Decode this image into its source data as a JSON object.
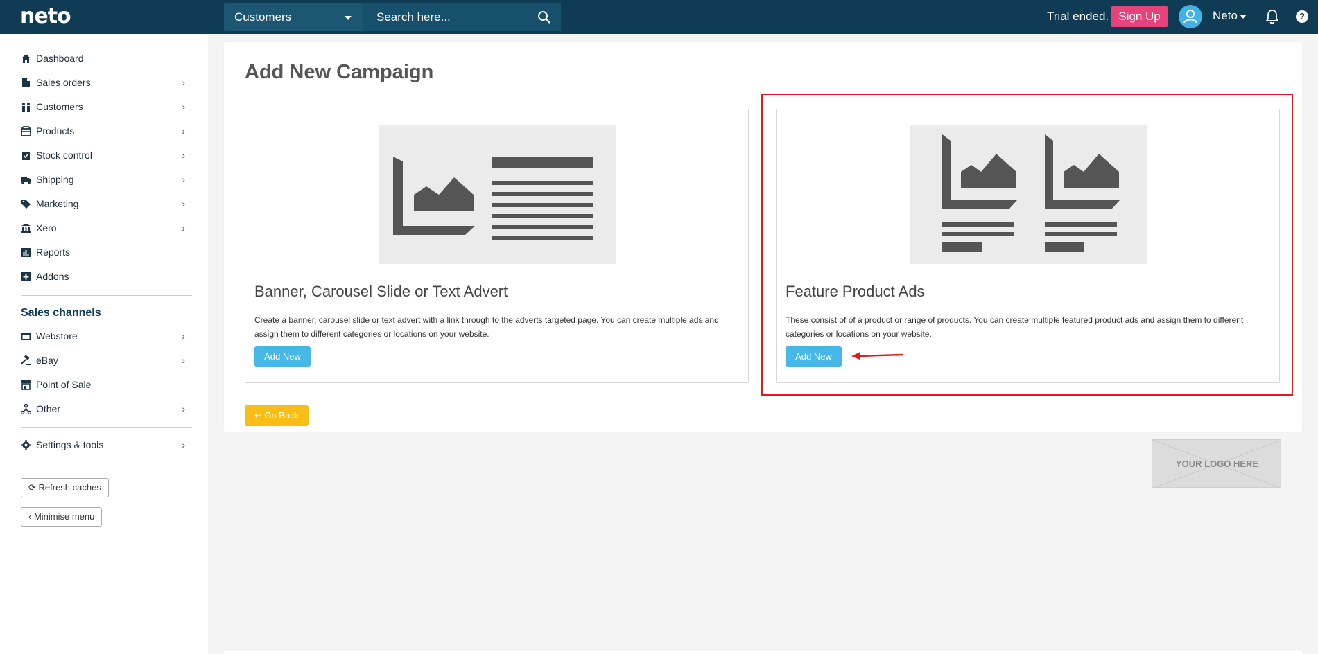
{
  "topbar": {
    "logo": "neto",
    "search_scope": "Customers",
    "search_placeholder": "Search here...",
    "trial_text": "Trial ended.",
    "signup_label": "Sign Up",
    "user_name": "Neto",
    "help_label": "?"
  },
  "sidebar": {
    "items": [
      {
        "label": "Dashboard",
        "icon": "home-icon",
        "chevron": ""
      },
      {
        "label": "Sales orders",
        "icon": "document-icon",
        "chevron": "›"
      },
      {
        "label": "Customers",
        "icon": "people-icon",
        "chevron": "›"
      },
      {
        "label": "Products",
        "icon": "box-icon",
        "chevron": "›"
      },
      {
        "label": "Stock control",
        "icon": "clipboard-check-icon",
        "chevron": "›"
      },
      {
        "label": "Shipping",
        "icon": "truck-icon",
        "chevron": "›"
      },
      {
        "label": "Marketing",
        "icon": "tag-icon",
        "chevron": "›"
      },
      {
        "label": "Xero",
        "icon": "bank-icon",
        "chevron": "›"
      },
      {
        "label": "Reports",
        "icon": "bar-chart-icon",
        "chevron": ""
      },
      {
        "label": "Addons",
        "icon": "plus-square-icon",
        "chevron": ""
      }
    ],
    "section_title": "Sales channels",
    "channels": [
      {
        "label": "Webstore",
        "icon": "browser-icon",
        "chevron": "›"
      },
      {
        "label": "eBay",
        "icon": "gavel-icon",
        "chevron": "›"
      },
      {
        "label": "Point of Sale",
        "icon": "store-icon",
        "chevron": ""
      },
      {
        "label": "Other",
        "icon": "network-icon",
        "chevron": "›"
      }
    ],
    "settings": {
      "label": "Settings & tools",
      "icon": "gear-icon",
      "chevron": "›"
    },
    "refresh_label": "Refresh caches",
    "minimise_label": "Minimise menu"
  },
  "main": {
    "title": "Add New Campaign",
    "cards": [
      {
        "title": "Banner, Carousel Slide or Text Advert",
        "description": "Create a banner, carousel slide or text advert with a link through to the adverts targeted page. You can create multiple ads and assign them to different categories or locations on your website.",
        "button": "Add New"
      },
      {
        "title": "Feature Product Ads",
        "description": "These consist of of a product or range of products. You can create multiple featured product ads and assign them to different categories or locations on your website.",
        "button": "Add New"
      }
    ],
    "go_back_label": "Go Back",
    "logo_placeholder": "YOUR LOGO HERE"
  },
  "colors": {
    "topbar_bg": "#0f3c54",
    "accent_blue": "#45b8e8",
    "signup_pink": "#e8427a",
    "go_back_yellow": "#f8bd16",
    "highlight_red": "#e41a1a"
  }
}
